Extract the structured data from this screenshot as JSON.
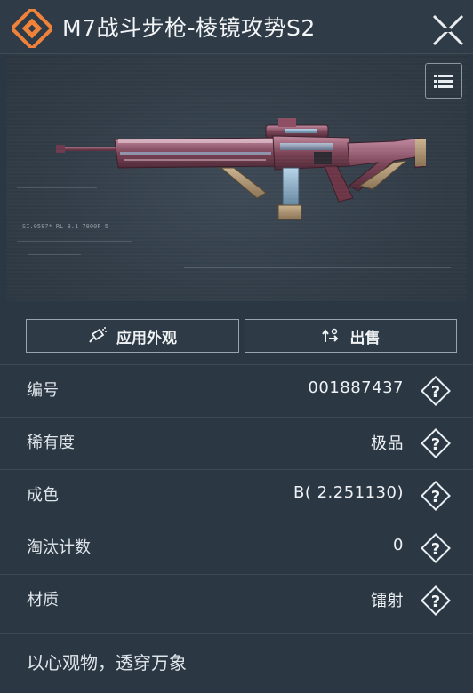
{
  "header": {
    "title": "M7战斗步枪-棱镜攻势S2",
    "logo_icon": "orange-diamond-logo-icon",
    "close_icon": "close-x-icon"
  },
  "preview": {
    "list_icon": "list-menu-icon",
    "hud_text": "SI.0587* RL 3.1 7800F 5"
  },
  "actions": {
    "apply_label": "应用外观",
    "apply_icon": "spray-can-icon",
    "sell_label": "出售",
    "sell_icon": "sell-arrows-icon"
  },
  "details": [
    {
      "label": "编号",
      "value": "001887437"
    },
    {
      "label": "稀有度",
      "value": "极品"
    },
    {
      "label": "成色",
      "value": "B( 2.251130)"
    },
    {
      "label": "淘汰计数",
      "value": "0"
    },
    {
      "label": "材质",
      "value": "镭射"
    }
  ],
  "quote": "以心观物，透穿万象",
  "colors": {
    "accent": "#f0823a",
    "panel": "#2b3742",
    "border": "#9aa4ad"
  }
}
